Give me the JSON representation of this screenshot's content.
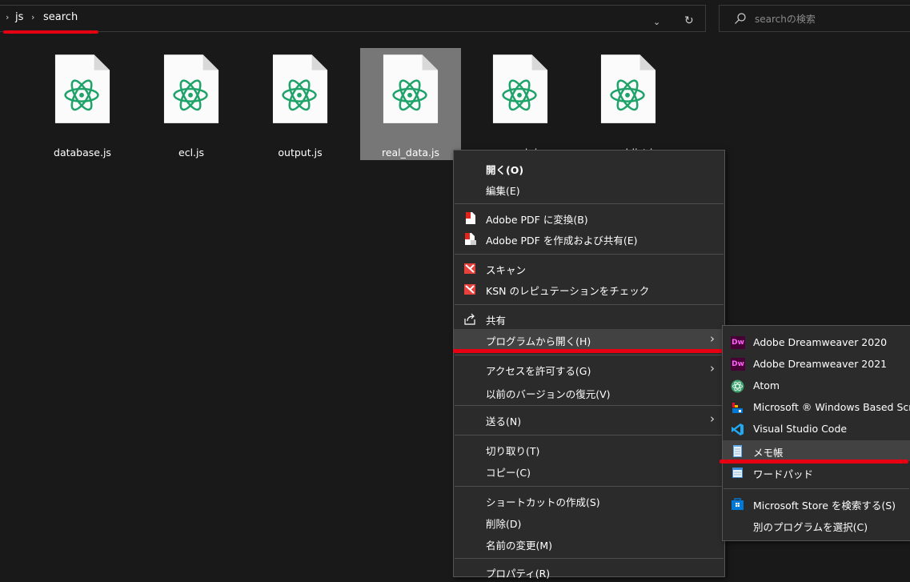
{
  "address_bar": {
    "breadcrumbs": [
      "js",
      "search"
    ],
    "search_placeholder": "searchの検索"
  },
  "files": [
    {
      "name": "database.js",
      "selected": false
    },
    {
      "name": "ecl.js",
      "selected": false
    },
    {
      "name": "output.js",
      "selected": false
    },
    {
      "name": "real_data.js",
      "selected": true
    },
    {
      "name": "search.js",
      "selected": false
    },
    {
      "name": "searchlist.js",
      "selected": false
    }
  ],
  "context_menu": {
    "items": [
      {
        "label": "開く(O)",
        "bold": true
      },
      {
        "label": "編集(E)"
      },
      {
        "label": "Adobe PDF に変換(B)",
        "icon": "adobe-pdf-icon"
      },
      {
        "label": "Adobe PDF を作成および共有(E)",
        "icon": "adobe-pdf-share-icon"
      },
      {
        "label": "スキャン",
        "icon": "kaspersky-icon"
      },
      {
        "label": "KSN のレピュテーションをチェック",
        "icon": "kaspersky-icon"
      },
      {
        "label": "共有",
        "icon": "share-icon"
      },
      {
        "label": "プログラムから開く(H)",
        "has_submenu": true,
        "highlighted": true
      },
      {
        "label": "アクセスを許可する(G)",
        "has_submenu": true
      },
      {
        "label": "以前のバージョンの復元(V)"
      },
      {
        "label": "送る(N)",
        "has_submenu": true
      },
      {
        "label": "切り取り(T)"
      },
      {
        "label": "コピー(C)"
      },
      {
        "label": "ショートカットの作成(S)"
      },
      {
        "label": "削除(D)"
      },
      {
        "label": "名前の変更(M)"
      },
      {
        "label": "プロパティ(R)"
      }
    ]
  },
  "open_with_submenu": {
    "items": [
      {
        "label": "Adobe Dreamweaver 2020",
        "icon": "dreamweaver-icon",
        "icon_text": "Dw"
      },
      {
        "label": "Adobe Dreamweaver 2021",
        "icon": "dreamweaver-icon",
        "icon_text": "Dw"
      },
      {
        "label": "Atom",
        "icon": "atom-icon"
      },
      {
        "label": "Microsoft ® Windows Based Script Host",
        "icon": "script-host-icon"
      },
      {
        "label": "Visual Studio Code",
        "icon": "vscode-icon"
      },
      {
        "label": "メモ帳",
        "icon": "notepad-icon",
        "highlighted": true
      },
      {
        "label": "ワードパッド",
        "icon": "wordpad-icon"
      },
      {
        "label": "Microsoft Store を検索する(S)",
        "icon": "microsoft-store-icon"
      },
      {
        "label": "別のプログラムを選択(C)"
      }
    ]
  },
  "colors": {
    "background": "#191919",
    "menu_background": "#2b2b2b",
    "highlight": "#424242",
    "annotation_red": "#e60012",
    "atom_green": "#1fa36a"
  }
}
